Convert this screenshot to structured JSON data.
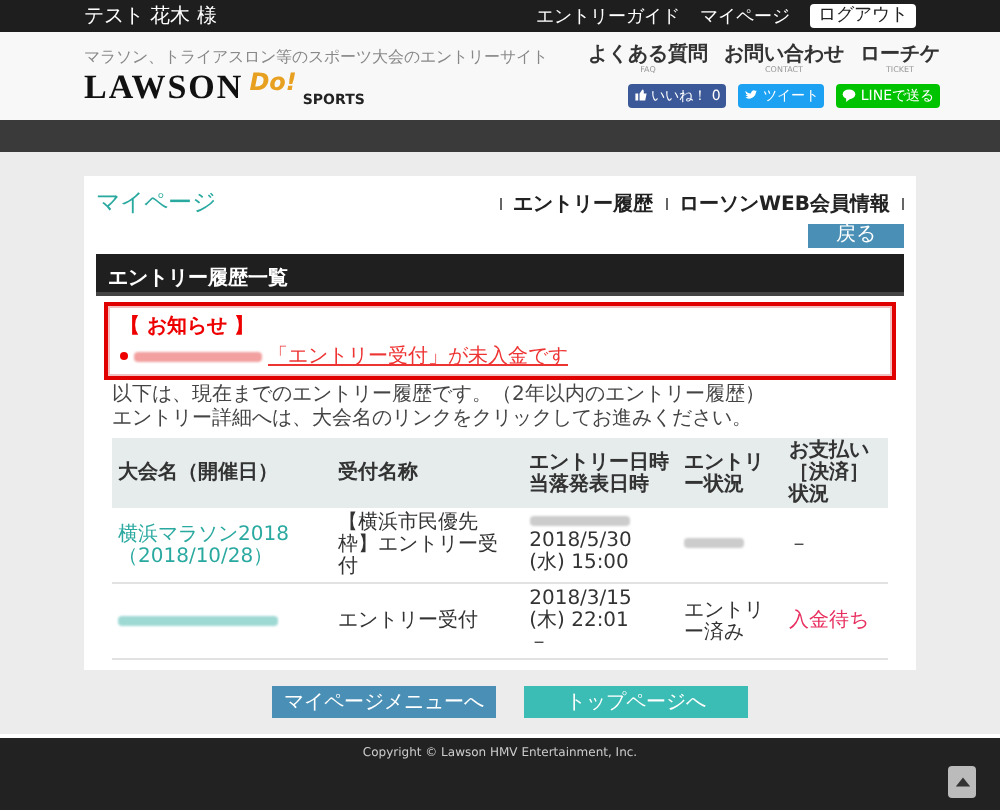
{
  "top_bar": {
    "user": "テスト 花木 様",
    "links": [
      "エントリーガイド",
      "マイページ"
    ],
    "logout": "ログアウト"
  },
  "header": {
    "tagline": "マラソン、トライアスロン等のスポーツ大会のエントリーサイト",
    "logo": {
      "main": "LAWSON",
      "accent": "Do!",
      "sub": "SPORTS"
    },
    "links": [
      {
        "label": "よくある質問",
        "sub": "FAQ"
      },
      {
        "label": "お問い合わせ",
        "sub": "CONTACT"
      },
      {
        "label": "ローチケ",
        "sub": "TICKET"
      }
    ],
    "share": [
      {
        "kind": "like",
        "label": "いいね！ 0"
      },
      {
        "kind": "tweet",
        "label": "ツイート"
      },
      {
        "kind": "line",
        "label": "LINEで送る"
      }
    ]
  },
  "page": {
    "title": "マイページ",
    "nav": [
      "エントリー履歴",
      "ローソンWEB会員情報"
    ],
    "back": "戻る",
    "section": "エントリー履歴一覧",
    "notice": {
      "heading": "【 お知らせ 】",
      "message": "「エントリー受付」が未入金です"
    },
    "description": [
      "以下は、現在までのエントリー履歴です。（2年以内のエントリー履歴）",
      "エントリー詳細へは、大会名のリンクをクリックしてお進みください。"
    ],
    "table": {
      "columns": [
        {
          "lines": [
            "大会名（開催日）"
          ]
        },
        {
          "lines": [
            "受付名称"
          ]
        },
        {
          "lines": [
            "エントリー日時",
            "当落発表日時"
          ]
        },
        {
          "lines": [
            "エントリー状況"
          ]
        },
        {
          "lines": [
            "お支払い［決済］状況"
          ]
        }
      ],
      "rows": [
        {
          "event": "横浜マラソン2018（2018/10/28）",
          "event_redacted": false,
          "reception": "【横浜市民優先枠】エントリー受付",
          "entry_redacted": true,
          "dates": [
            "2018/5/30 (水) 15:00"
          ],
          "status": "",
          "status_redacted": true,
          "payment": "－",
          "payment_alert": false
        },
        {
          "event": "",
          "event_redacted": true,
          "reception": "エントリー受付",
          "entry_redacted": false,
          "dates": [
            "2018/3/15 (木) 22:01",
            "－"
          ],
          "status": "エントリー済み",
          "status_redacted": false,
          "payment": "入金待ち",
          "payment_alert": true
        }
      ]
    }
  },
  "buttons": [
    {
      "kind": "menu",
      "label": "マイページメニューへ"
    },
    {
      "kind": "top",
      "label": "トップページへ"
    }
  ],
  "footer": {
    "copyright": "Copyright © Lawson HMV Entertainment, Inc."
  }
}
